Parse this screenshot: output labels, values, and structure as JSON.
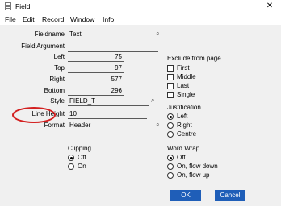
{
  "window": {
    "title": "Field",
    "close_glyph": "✕"
  },
  "menu": [
    "File",
    "Edit",
    "Record",
    "Window",
    "Info"
  ],
  "fields": {
    "fieldname": {
      "label": "Fieldname",
      "value": "Text"
    },
    "field_argument": {
      "label": "Field Argument",
      "value": ""
    },
    "left": {
      "label": "Left",
      "value": "75"
    },
    "top": {
      "label": "Top",
      "value": "97"
    },
    "right": {
      "label": "Right",
      "value": "577"
    },
    "bottom": {
      "label": "Bottom",
      "value": "296"
    },
    "style": {
      "label": "Style",
      "value": "FIELD_T"
    },
    "line_height": {
      "label": "Line Height",
      "value": "10"
    },
    "format": {
      "label": "Format",
      "value": "Header"
    }
  },
  "exclude_from_page": {
    "title": "Exclude from page",
    "options": [
      {
        "label": "First",
        "checked": false
      },
      {
        "label": "Middle",
        "checked": false
      },
      {
        "label": "Last",
        "checked": false
      },
      {
        "label": "Single",
        "checked": false
      }
    ]
  },
  "justification": {
    "title": "Justification",
    "options": [
      "Left",
      "Right",
      "Centre"
    ],
    "selected": "Left"
  },
  "clipping": {
    "title": "Clipping",
    "options": [
      "Off",
      "On"
    ],
    "selected": "Off"
  },
  "word_wrap": {
    "title": "Word Wrap",
    "options": [
      "Off",
      "On, flow down",
      "On, flow up"
    ],
    "selected": "Off"
  },
  "buttons": {
    "ok": "OK",
    "cancel": "Cancel"
  },
  "lookup_glyph": "⌕",
  "colors": {
    "button": "#1f5eb8",
    "highlight": "#d32020",
    "panel": "#f0f0f0"
  }
}
